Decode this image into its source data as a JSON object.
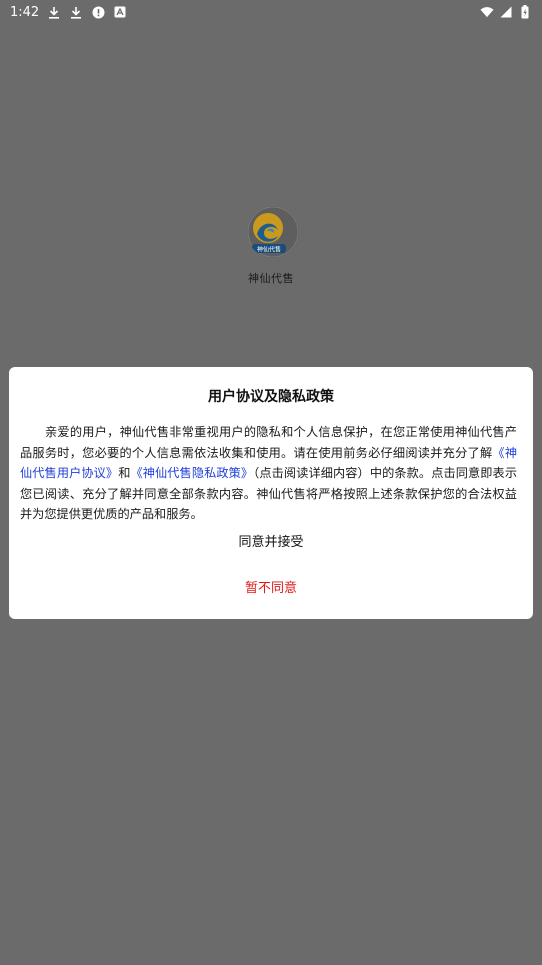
{
  "status_bar": {
    "time": "1:42",
    "icons_left": [
      "download-icon",
      "download-icon",
      "alert-icon",
      "app-notification-icon"
    ],
    "icons_right": [
      "wifi-icon",
      "signal-icon",
      "battery-icon"
    ]
  },
  "app": {
    "name": "神仙代售"
  },
  "dialog": {
    "title": "用户协议及隐私政策",
    "body_part1": "亲爱的用户，神仙代售非常重视用户的隐私和个人信息保护，在您正常使用神仙代售产品服务时，您必要的个人信息需依法收集和使用。请在使用前务必仔细阅读并充分了解",
    "link_user_agreement": "《神仙代售用户协议》",
    "and_text": "和",
    "link_privacy_policy": "《神仙代售隐私政策》",
    "body_part2": "（点击阅读详细内容）中的条款。点击同意即表示您已阅读、充分了解并同意全部条款内容。神仙代售将严格按照上述条款保护您的合法权益并为您提供更优质的产品和服务。",
    "accept_label": "同意并接受",
    "decline_label": "暂不同意"
  },
  "colors": {
    "overlay": "#6b6b6b",
    "link": "#1f3fd8",
    "decline": "#e01818"
  }
}
